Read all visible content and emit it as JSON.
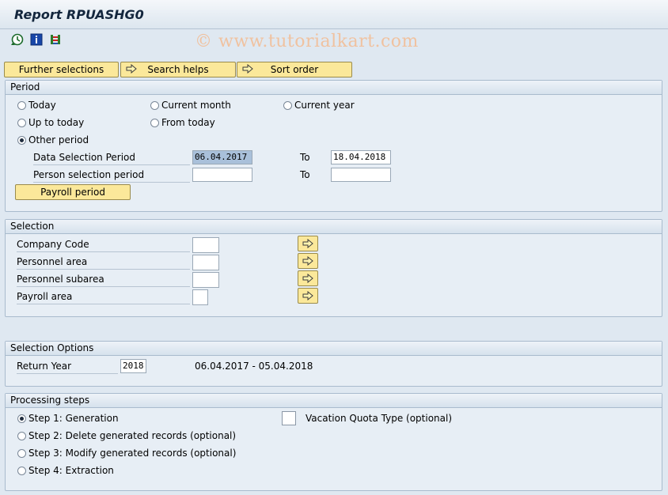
{
  "title": "Report RPUASHG0",
  "watermark": "© www.tutorialkart.com",
  "toolbar": {
    "execute_icon": "execute-clock-icon",
    "info_icon": "info-icon",
    "selection_icon": "selection-screen-icon"
  },
  "top_buttons": {
    "further_selections": "Further selections",
    "search_helps": "Search helps",
    "sort_order": "Sort order"
  },
  "period": {
    "header": "Period",
    "today": "Today",
    "current_month": "Current month",
    "current_year": "Current year",
    "up_to_today": "Up to today",
    "from_today": "From today",
    "other_period": "Other period",
    "data_selection_label": "Data Selection Period",
    "data_selection_from": "06.04.2017",
    "to_label_1": "To",
    "data_selection_to": "18.04.2018",
    "person_selection_label": "Person selection period",
    "person_selection_from": "",
    "to_label_2": "To",
    "person_selection_to": "",
    "payroll_button": "Payroll period"
  },
  "selection": {
    "header": "Selection",
    "company_code": "Company Code",
    "personnel_area": "Personnel area",
    "personnel_subarea": "Personnel subarea",
    "payroll_area": "Payroll area"
  },
  "selection_options": {
    "header": "Selection Options",
    "return_year_label": "Return Year",
    "return_year_value": "2018",
    "range_text": "06.04.2017 - 05.04.2018"
  },
  "processing": {
    "header": "Processing steps",
    "step1": "Step 1: Generation",
    "step2": "Step 2: Delete generated records (optional)",
    "step3": "Step 3: Modify generated records (optional)",
    "step4": "Step 4: Extraction",
    "vacation_quota": "Vacation Quota Type (optional)"
  },
  "colors": {
    "button_yellow": "#fbe89a",
    "group_bg": "#e7eef5",
    "selected_field": "#a9c0da"
  }
}
